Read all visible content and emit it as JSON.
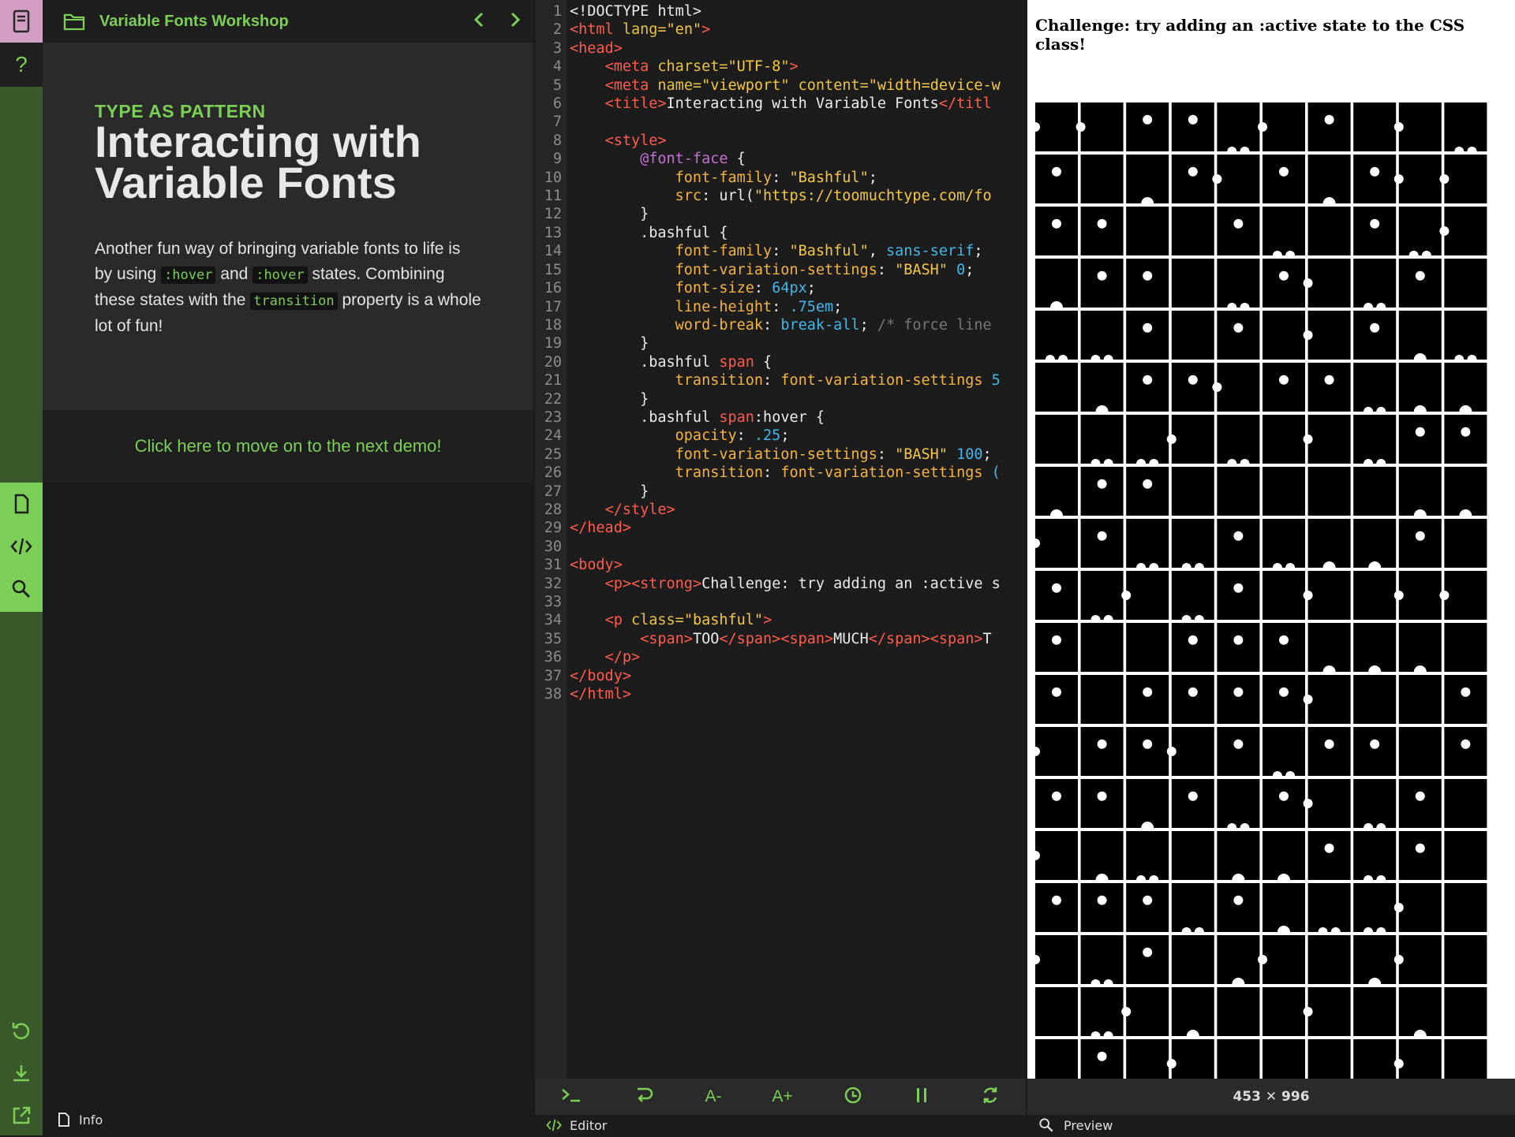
{
  "app": {
    "workshop_title": "Variable Fonts Workshop"
  },
  "info": {
    "eyebrow": "TYPE AS PATTERN",
    "heading": "Interacting with Variable Fonts",
    "desc_part1": "Another fun way of bringing variable fonts to life is by using ",
    "chip1": ":hover",
    "desc_part2": " and ",
    "chip2": ":hover",
    "desc_part3": " states. Combining these states with the ",
    "chip3": "transition",
    "desc_part4": " property is a whole lot of fun!",
    "next_link": "Click here to move on to the next demo!",
    "footer_label": "Info"
  },
  "editor": {
    "footer_label": "Editor",
    "toolbar": [
      "terminal-icon",
      "wrap-icon",
      "font-decrease-icon",
      "font-increase-icon",
      "history-icon",
      "pause-icon",
      "refresh-icon"
    ]
  },
  "preview": {
    "challenge_text": "Challenge: try adding an :active state to the CSS class!",
    "size_label": "453 ✕ 996",
    "footer_label": "Preview"
  },
  "colors": {
    "accent_green": "#7bcf56",
    "rail_green": "#3b5a2c",
    "book_pink": "#d39ec3"
  }
}
